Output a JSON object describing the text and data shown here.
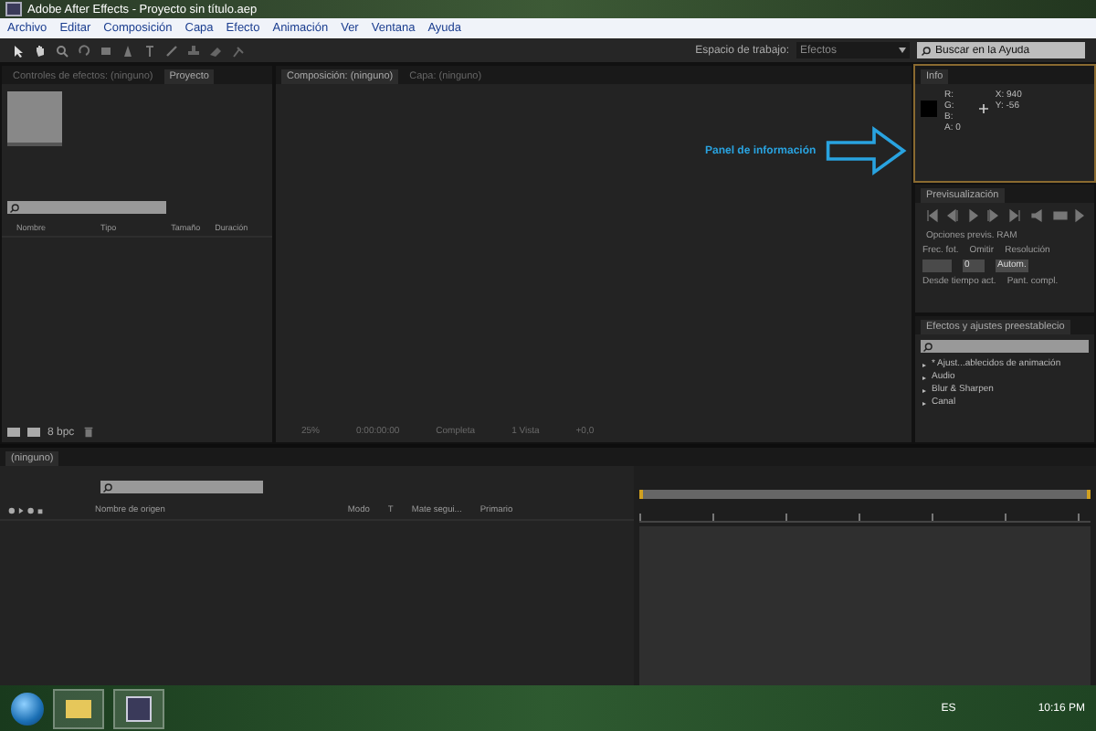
{
  "window": {
    "title": "Adobe After Effects - Proyecto sin título.aep"
  },
  "menu": [
    "Archivo",
    "Editar",
    "Composición",
    "Capa",
    "Efecto",
    "Animación",
    "Ver",
    "Ventana",
    "Ayuda"
  ],
  "toolbar": {
    "workspace_label": "Espacio de trabajo:",
    "workspace_value": "Efectos",
    "help_search": {
      "placeholder": "Buscar en la Ayuda"
    }
  },
  "left_panel": {
    "tabs": [
      {
        "label": "Controles de efectos: (ninguno)",
        "selected": false
      },
      {
        "label": "Proyecto",
        "selected": true
      }
    ],
    "columns": [
      "Nombre",
      "Tipo",
      "Tamaño",
      "Duración"
    ],
    "bit_depth": "8 bpc"
  },
  "composition_panel": {
    "tabs": [
      {
        "label": "Composición: (ninguno)",
        "selected": true
      },
      {
        "label": "Capa: (ninguno)",
        "selected": false
      }
    ],
    "footer": [
      "25%",
      "0:00:00:00",
      "Completa",
      "1 Vista",
      "+0,0"
    ]
  },
  "annotation": {
    "text": "Panel de información"
  },
  "info_panel": {
    "tab": "Info",
    "channels": [
      "R:",
      "G:",
      "B:",
      "A: 0"
    ],
    "coords": [
      "X: 940",
      "Y: -56"
    ]
  },
  "preview_panel": {
    "tab": "Previsualización",
    "ram_options": "Opciones previs. RAM",
    "labels": [
      "Frec. fot.",
      "Omitir",
      "Resolución"
    ],
    "values": [
      "0",
      "Autom."
    ],
    "options": [
      "Desde tiempo act.",
      "Pant. compl."
    ]
  },
  "effects_panel": {
    "tab": "Efectos y ajustes preestablecio",
    "items": [
      {
        "label": "* Ajust...ablecidos de animación",
        "expanded": false
      },
      {
        "label": "Audio",
        "expanded": false
      },
      {
        "label": "Blur & Sharpen",
        "expanded": false
      },
      {
        "label": "Canal",
        "expanded": false
      }
    ]
  },
  "timeline": {
    "tab": "(ninguno)",
    "columns": [
      "Nombre de origen",
      "Modo",
      "T",
      "Mate segui...",
      "Primario"
    ]
  },
  "taskbar": {
    "language": "ES",
    "clock": "10:16 PM"
  }
}
